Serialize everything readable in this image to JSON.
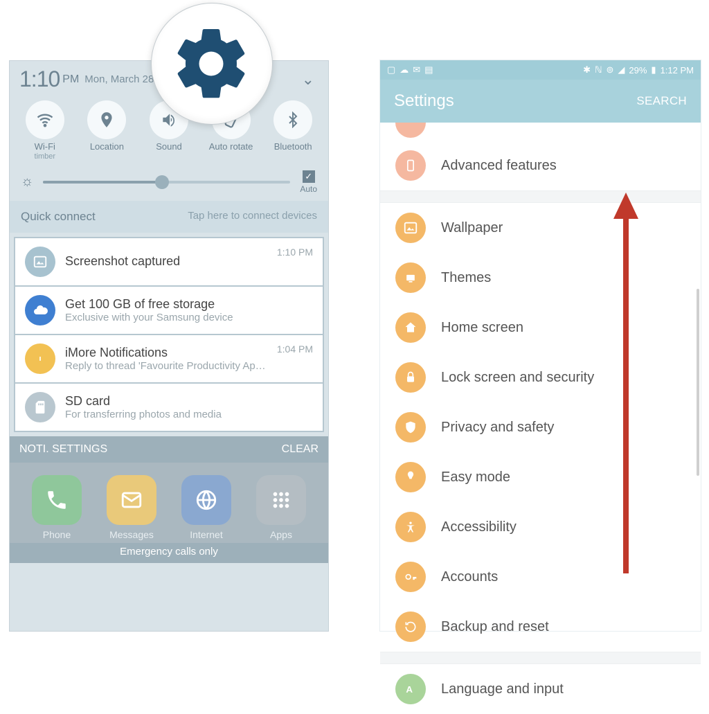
{
  "left": {
    "time": "1:10",
    "ampm": "PM",
    "date": "Mon, March 28",
    "quick": [
      {
        "label": "Wi-Fi",
        "sub": "timber",
        "glyph": "wifi"
      },
      {
        "label": "Location",
        "sub": "",
        "glyph": "pin"
      },
      {
        "label": "Sound",
        "sub": "",
        "glyph": "sound"
      },
      {
        "label": "Auto rotate",
        "sub": "",
        "glyph": "rotate"
      },
      {
        "label": "Bluetooth",
        "sub": "",
        "glyph": "bt"
      }
    ],
    "brightness_auto": "Auto",
    "quick_connect": {
      "title": "Quick connect",
      "hint": "Tap here to connect devices"
    },
    "notifications": [
      {
        "title": "Screenshot captured",
        "sub": "",
        "time": "1:10 PM",
        "icon_color": "#a7c2cf",
        "glyph": "image"
      },
      {
        "title": "Get 100 GB of free storage",
        "sub": "Exclusive with your Samsung device",
        "time": "",
        "icon_color": "#3f7fd1",
        "glyph": "cloud"
      },
      {
        "title": "iMore Notifications",
        "sub": "Reply to thread 'Favourite Productivity Apps!'  luke.filipowicz@smartphonexperts.com",
        "time": "1:04 PM",
        "icon_color": "#f2c153",
        "glyph": "dot"
      },
      {
        "title": "SD card",
        "sub": "For transferring photos and media",
        "time": "",
        "icon_color": "#b9c7cf",
        "glyph": "sd"
      }
    ],
    "footer": {
      "settings": "NOTI. SETTINGS",
      "clear": "CLEAR"
    },
    "dock": [
      {
        "label": "Phone",
        "color": "#8fc79b",
        "glyph": "phone"
      },
      {
        "label": "Messages",
        "color": "#e9c97a",
        "glyph": "mail"
      },
      {
        "label": "Internet",
        "color": "#8aa8d0",
        "glyph": "globe"
      },
      {
        "label": "Apps",
        "color": "#b4bdc3",
        "glyph": "grid"
      }
    ],
    "emergency": "Emergency calls only"
  },
  "right": {
    "status": {
      "battery_text": "29%",
      "time": "1:12 PM"
    },
    "appbar": {
      "title": "Settings",
      "search": "SEARCH"
    },
    "items": [
      {
        "label": "Advanced features",
        "color": "#f5b8a0",
        "glyph": "phone-rect"
      },
      {
        "divider": true
      },
      {
        "label": "Wallpaper",
        "color": "#f4b867",
        "glyph": "image"
      },
      {
        "label": "Themes",
        "color": "#f4b867",
        "glyph": "themes"
      },
      {
        "label": "Home screen",
        "color": "#f4b867",
        "glyph": "home"
      },
      {
        "label": "Lock screen and security",
        "color": "#f4b867",
        "glyph": "lock"
      },
      {
        "label": "Privacy and safety",
        "color": "#f4b867",
        "glyph": "privacy"
      },
      {
        "label": "Easy mode",
        "color": "#f4b867",
        "glyph": "easy"
      },
      {
        "label": "Accessibility",
        "color": "#f4b867",
        "glyph": "a11y"
      },
      {
        "label": "Accounts",
        "color": "#f4b867",
        "glyph": "key"
      },
      {
        "label": "Backup and reset",
        "color": "#f4b867",
        "glyph": "backup"
      },
      {
        "divider": true
      },
      {
        "label": "Language and input",
        "color": "#a9d49a",
        "glyph": "lang"
      }
    ]
  }
}
